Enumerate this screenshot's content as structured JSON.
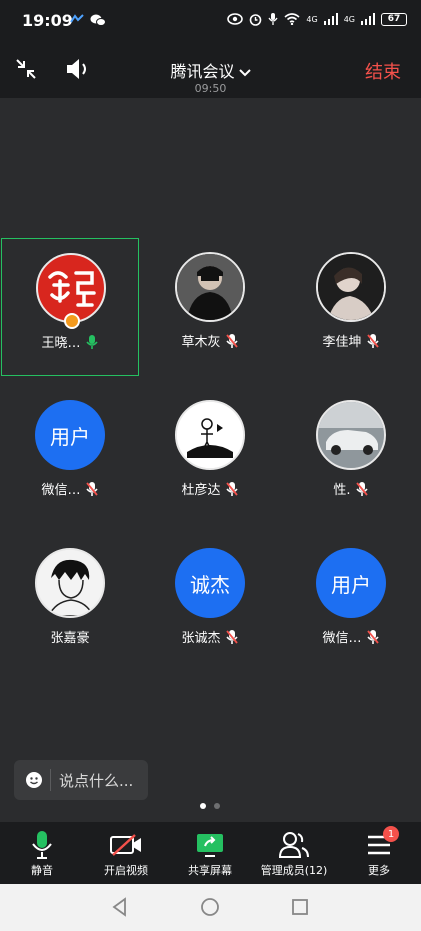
{
  "status": {
    "time": "19:09",
    "battery": "67",
    "net1": "4G",
    "net2": "4G"
  },
  "header": {
    "title": "腾讯会议",
    "time": "09:50",
    "end_label": "结束"
  },
  "participants": [
    {
      "name": "王晓…",
      "avatar_type": "image",
      "avatar_desc": "red-calligraphy",
      "mic": "on",
      "active": true
    },
    {
      "name": "草木灰",
      "avatar_type": "image",
      "avatar_desc": "photo",
      "mic": "off"
    },
    {
      "name": "李佳坤",
      "avatar_type": "image",
      "avatar_desc": "photo",
      "mic": "off"
    },
    {
      "name": "微信…",
      "avatar_type": "text",
      "avatar_text": "用户",
      "mic": "off"
    },
    {
      "name": "杜彦达",
      "avatar_type": "image",
      "avatar_desc": "sketch",
      "mic": "off"
    },
    {
      "name": "性.",
      "avatar_type": "image",
      "avatar_desc": "car-photo",
      "mic": "off"
    },
    {
      "name": "张嘉豪",
      "avatar_type": "image",
      "avatar_desc": "anime",
      "mic": "none"
    },
    {
      "name": "张诚杰",
      "avatar_type": "text",
      "avatar_text": "诚杰",
      "mic": "off"
    },
    {
      "name": "微信…",
      "avatar_type": "text",
      "avatar_text": "用户",
      "mic": "off"
    }
  ],
  "chat": {
    "placeholder": "说点什么..."
  },
  "toolbar": {
    "mute_label": "静音",
    "video_label": "开启视频",
    "share_label": "共享屏幕",
    "members_label": "管理成员(12)",
    "more_label": "更多",
    "more_badge": "1"
  },
  "colors": {
    "accent_green": "#25c061",
    "end_red": "#f4514b",
    "avatar_blue": "#1d6ff2"
  }
}
